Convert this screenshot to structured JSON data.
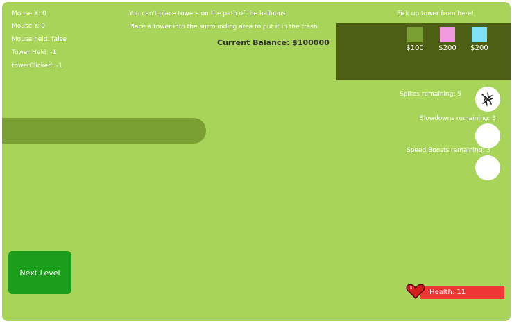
{
  "debug": {
    "mouse_x": "Mouse X: 0",
    "mouse_y": "Mouse Y: 0",
    "mouse_held": "Mouse held: false",
    "tower_held": "Tower Held: -1",
    "tower_clicked": "towerClicked: -1"
  },
  "notices": {
    "line1": "You can't place towers on the path of the balloons!",
    "line2": "Place a tower into the surrounding area to put it in the trash."
  },
  "balance": "Current Balance: $100000",
  "shop": {
    "title": "Pick up tower from here!",
    "towers": [
      {
        "price": "$100",
        "color": "#7a9f32"
      },
      {
        "price": "$200",
        "color": "#f29ae0"
      },
      {
        "price": "$200",
        "color": "#7fe1f5"
      }
    ]
  },
  "abilities": {
    "spikes": "Spikes remaining: 5",
    "slowdowns": "Slowdowns remaining: 3",
    "speed_boosts": "Speed Boosts remaining: 3"
  },
  "next_level": "Next Level",
  "health": {
    "label": "Health:  11"
  },
  "colors": {
    "field": "#a8d45a",
    "path": "#7a9f32",
    "shop_bg": "#4d5f12",
    "next_level": "#1c9e1c",
    "health_bar": "#f03535",
    "heart": "#d41f1f"
  }
}
